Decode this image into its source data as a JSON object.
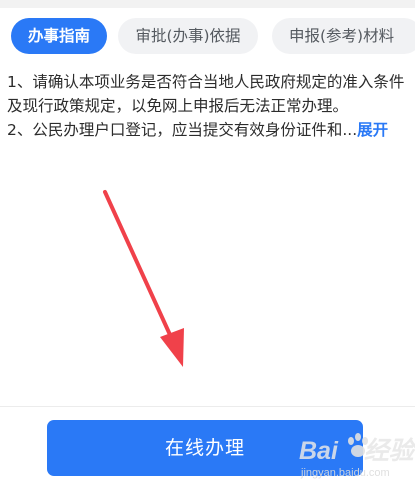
{
  "tabs": [
    {
      "label": "办事指南",
      "active": true
    },
    {
      "label": "审批(办事)依据",
      "active": false
    },
    {
      "label": "申报(参考)材料",
      "active": false
    }
  ],
  "content": {
    "line1": "1、请确认本项业务是否符合当地人民政府规定的准入条件",
    "line2": "及现行政策规定，以免网上申报后无法正常办理。",
    "line3": "2、公民办理户口登记，应当提交有效身份证件和...",
    "expand_label": "展开"
  },
  "bottom": {
    "button_label": "在线办理"
  },
  "watermark": {
    "main_a": "Bai",
    "main_b": "经验",
    "sub": "jingyan.baidu.com"
  },
  "colors": {
    "accent": "#2a79f6",
    "arrow": "#f0414a"
  }
}
